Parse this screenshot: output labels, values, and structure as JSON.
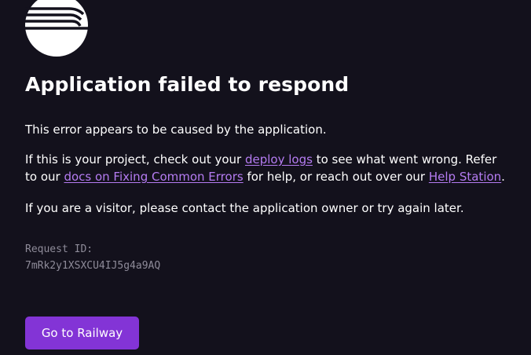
{
  "logo": {
    "icon": "railway-train-icon"
  },
  "title": "Application failed to respond",
  "messages": {
    "cause": "This error appears to be caused by the application.",
    "project_prefix": "If this is your project, check out your ",
    "deploy_logs_link": "deploy logs",
    "project_middle": " to see what went wrong. Refer to our ",
    "docs_link": "docs on Fixing Common Errors",
    "project_help": " for help, or reach out over our ",
    "help_station_link": "Help Station",
    "project_suffix": ".",
    "visitor": "If you are a visitor, please contact the application owner or try again later."
  },
  "request": {
    "label": "Request ID:",
    "id": "7mRk2y1XSXCU4IJ5g4a9AQ"
  },
  "button": {
    "label": "Go to Railway"
  },
  "colors": {
    "background": "#13111c",
    "link": "#b57cf2",
    "button": "#8334d6",
    "muted": "#8e8b99"
  }
}
